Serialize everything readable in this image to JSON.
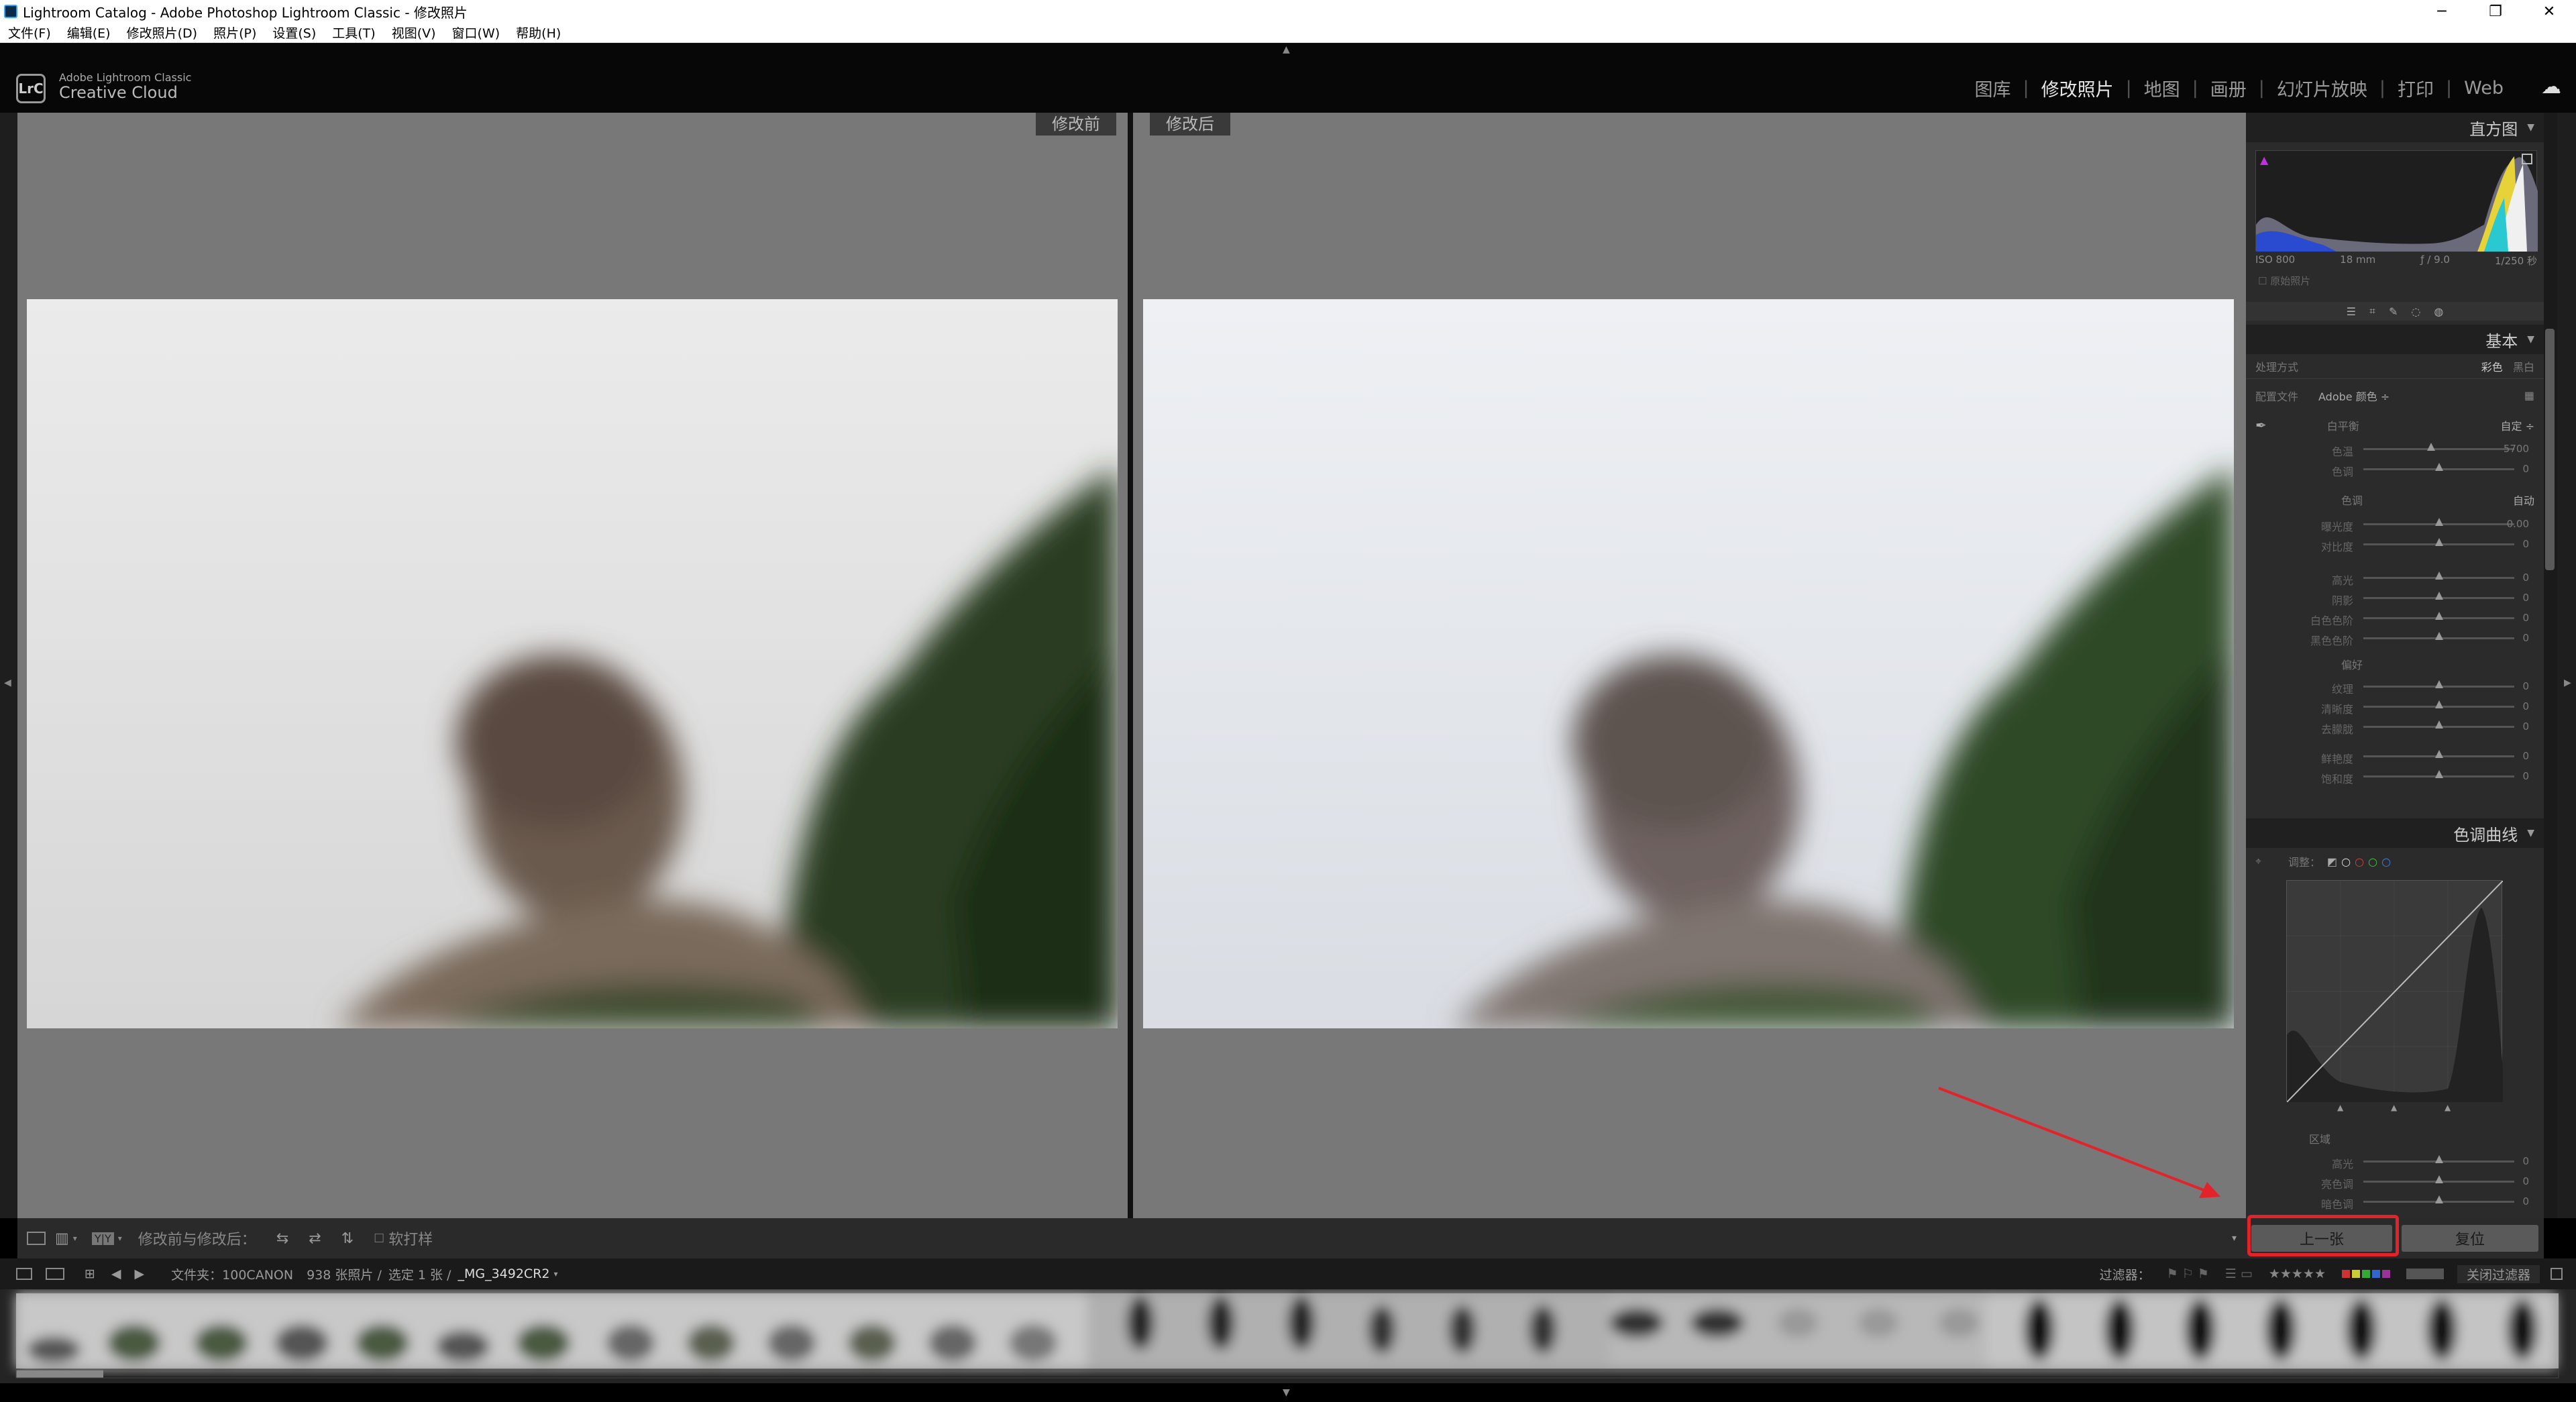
{
  "window": {
    "title": "Lightroom Catalog - Adobe Photoshop Lightroom Classic - 修改照片",
    "controls": [
      "─",
      "❐",
      "✕"
    ]
  },
  "menu": [
    "文件(F)",
    "编辑(E)",
    "修改照片(D)",
    "照片(P)",
    "设置(S)",
    "工具(T)",
    "视图(V)",
    "窗口(W)",
    "帮助(H)"
  ],
  "identity": {
    "logo": "LrC",
    "line1": "Adobe Lightroom Classic",
    "line2": "Creative Cloud"
  },
  "modules": [
    {
      "label": "图库",
      "active": false
    },
    {
      "label": "修改照片",
      "active": true
    },
    {
      "label": "地图",
      "active": false
    },
    {
      "label": "画册",
      "active": false
    },
    {
      "label": "幻灯片放映",
      "active": false
    },
    {
      "label": "打印",
      "active": false
    },
    {
      "label": "Web",
      "active": false
    }
  ],
  "view": {
    "before_label": "修改前",
    "after_label": "修改后"
  },
  "histogram": {
    "title": "直方图",
    "iso": "ISO 800",
    "focal": "18 mm",
    "aperture": "ƒ / 9.0",
    "shutter": "1/250 秒",
    "original": "原始照片"
  },
  "basic": {
    "title": "基本",
    "treatment_label": "处理方式",
    "treatment_color": "彩色",
    "treatment_bw": "黑白",
    "profile_label": "配置文件",
    "profile_value": "Adobe 颜色 ÷",
    "wb_label": "白平衡",
    "wb_value": "自定 ÷",
    "tone_label": "色调",
    "tone_auto": "自动",
    "presence_label": "偏好",
    "sliders": [
      {
        "label": "色温",
        "value": "5700",
        "pos": 0.45
      },
      {
        "label": "色调",
        "value": "0",
        "pos": 0.5
      },
      {
        "label": "曝光度",
        "value": "0.00",
        "pos": 0.5
      },
      {
        "label": "对比度",
        "value": "0",
        "pos": 0.5
      },
      {
        "label": "高光",
        "value": "0",
        "pos": 0.5
      },
      {
        "label": "阴影",
        "value": "0",
        "pos": 0.5
      },
      {
        "label": "白色色阶",
        "value": "0",
        "pos": 0.5
      },
      {
        "label": "黑色色阶",
        "value": "0",
        "pos": 0.5
      },
      {
        "label": "纹理",
        "value": "0",
        "pos": 0.5
      },
      {
        "label": "清晰度",
        "value": "0",
        "pos": 0.5
      },
      {
        "label": "去朦胧",
        "value": "0",
        "pos": 0.5
      },
      {
        "label": "鲜艳度",
        "value": "0",
        "pos": 0.5
      },
      {
        "label": "饱和度",
        "value": "0",
        "pos": 0.5
      }
    ]
  },
  "tone_curve": {
    "title": "色调曲线",
    "adjust_label": "调整：",
    "region_label": "区域",
    "sliders": [
      {
        "label": "高光",
        "value": "0",
        "pos": 0.5
      },
      {
        "label": "亮色调",
        "value": "0",
        "pos": 0.5
      },
      {
        "label": "暗色调",
        "value": "0",
        "pos": 0.5
      }
    ]
  },
  "toolbar": {
    "compare_label": "修改前与修改后：",
    "yy": "Y|Y",
    "soft_proof": "软打样"
  },
  "buttons": {
    "previous": "上一张",
    "reset": "复位"
  },
  "filmstrip_bar": {
    "folder": "文件夹：100CANON",
    "count": "938 张照片 /",
    "selected": "选定 1 张 /",
    "filename": "_MG_3492CR2",
    "filter_label": "过滤器：",
    "stars": "★★★★★",
    "filter_off": "关闭过滤器"
  },
  "colors": {
    "accent": "#e2232a",
    "panel": "#2b2b2b",
    "canvas": "#787878"
  }
}
